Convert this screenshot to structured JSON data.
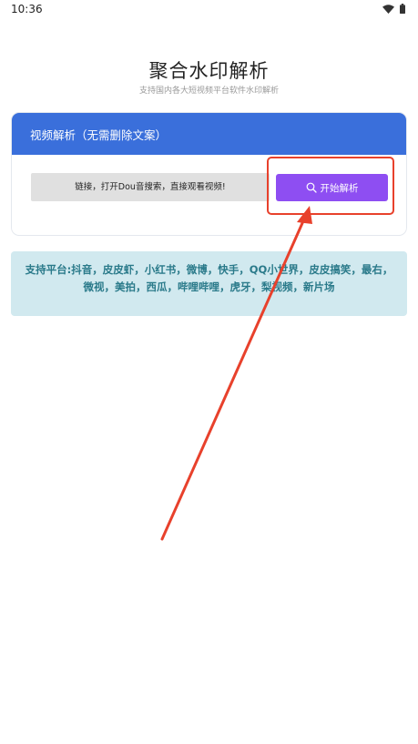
{
  "status_bar": {
    "time": "10:36",
    "icons": [
      "wifi-icon",
      "battery-icon"
    ]
  },
  "header": {
    "title": "聚合水印解析",
    "subtitle": "支持国内各大短视频平台软件水印解析"
  },
  "parse_card": {
    "header_label": "视频解析（无需删除文案）",
    "input_placeholder": "链接，打开Dou音搜索，直接观看视频!",
    "start_button_label": "开始解析",
    "start_button_icon": "search-icon"
  },
  "platforms": {
    "text": "支持平台:抖音，皮皮虾，小红书，微博，快手，QQ小世界，皮皮搞笑，最右，微视，美拍，西瓜，哔哩哔哩，虎牙，梨视频，新片场"
  },
  "colors": {
    "card_header_bg": "#3a6fdb",
    "button_bg": "#8e4ef2",
    "platform_bg": "#d1e9ef",
    "platform_text": "#2a7a8a",
    "annotation_red": "#e8412c"
  }
}
